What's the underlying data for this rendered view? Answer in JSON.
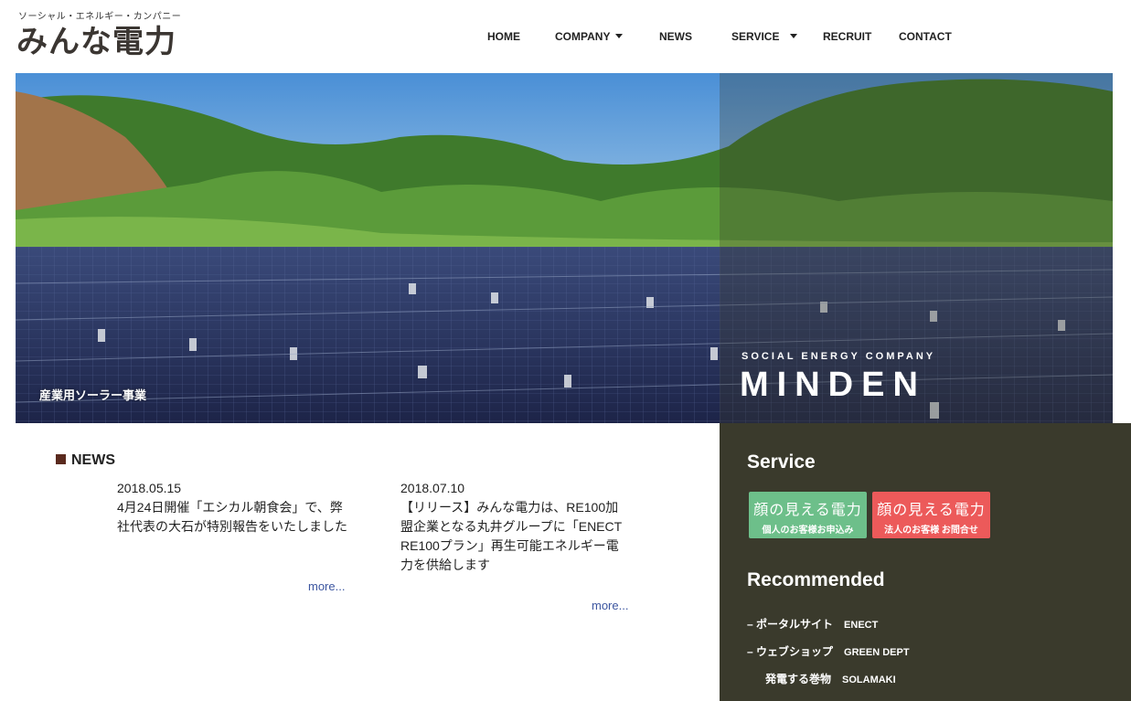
{
  "header": {
    "tagline": "ソーシャル・エネルギー・カンパニー",
    "logo": "みんな電力"
  },
  "nav": {
    "items": [
      {
        "label": "HOME",
        "has_dropdown": false
      },
      {
        "label": "COMPANY",
        "has_dropdown": true
      },
      {
        "label": "NEWS",
        "has_dropdown": false
      },
      {
        "label": "SERVICE",
        "has_dropdown": true
      },
      {
        "label": "RECRUIT",
        "has_dropdown": false
      },
      {
        "label": "CONTACT",
        "has_dropdown": false
      }
    ]
  },
  "hero": {
    "caption": "産業用ソーラー事業",
    "brand_sub": "SOCIAL ENERGY COMPANY",
    "brand_main": "MINDEN"
  },
  "news": {
    "heading": "NEWS",
    "items": [
      {
        "date": "2018.05.15",
        "text": "4月24日開催「エシカル朝食会」で、弊社代表の大石が特別報告をいたしました",
        "more": "more..."
      },
      {
        "date": "2018.07.10",
        "text": "【リリース】みんな電力は、RE100加盟企業となる丸井グループに「ENECT RE100プラン」再生可能エネルギー電力を供給します",
        "more": "more..."
      }
    ]
  },
  "sidebar": {
    "service_title": "Service",
    "service_buttons": [
      {
        "big": "顔の見える電力",
        "small": "個人のお客様お申込み",
        "color": "#6dbf8a"
      },
      {
        "big": "顔の見える電力",
        "small": "法人のお客様 お問合せ",
        "color": "#ec5a5a"
      }
    ],
    "recommended_title": "Recommended",
    "recommended": [
      {
        "prefix": "–",
        "label": "ポータルサイト",
        "site": "ENECT"
      },
      {
        "prefix": "–",
        "label": "ウェブショップ",
        "site": "GREEN DEPT"
      },
      {
        "prefix": "",
        "label": "発電する巻物",
        "site": "SOLAMAKI"
      }
    ]
  },
  "colors": {
    "sidebar_bg": "#3a3a2c",
    "link": "#3c56a0",
    "news_square": "#5a2a1e"
  }
}
